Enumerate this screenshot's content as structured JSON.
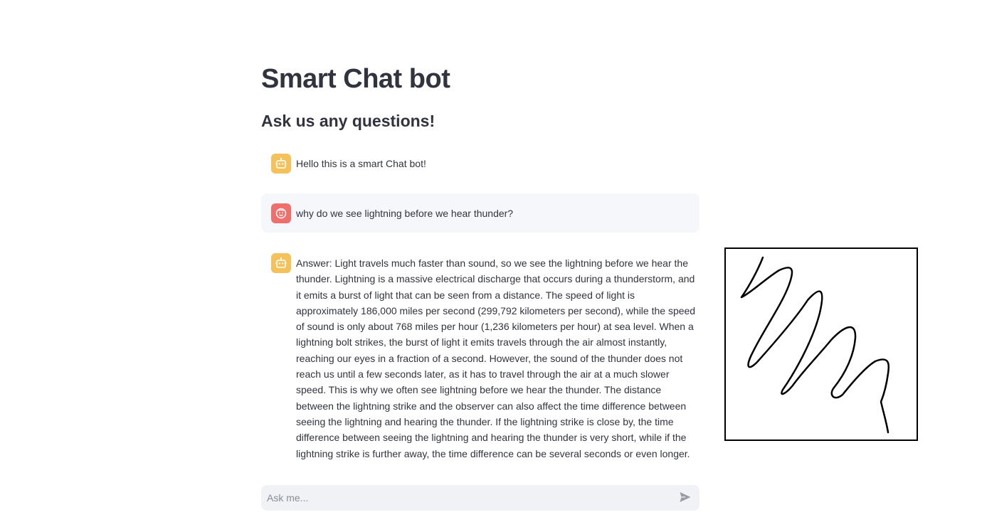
{
  "header": {
    "title": "Smart Chat bot",
    "subtitle": "Ask us any questions!"
  },
  "messages": [
    {
      "role": "assistant",
      "avatar_icon": "robot-face-icon",
      "text": "Hello this is a smart Chat bot!"
    },
    {
      "role": "user",
      "avatar_icon": "smiley-face-icon",
      "text": "why do we see lightning before we hear thunder?"
    },
    {
      "role": "assistant",
      "avatar_icon": "robot-face-icon",
      "text": "Answer: Light travels much faster than sound, so we see the lightning before we hear the thunder. Lightning is a massive electrical discharge that occurs during a thunderstorm, and it emits a burst of light that can be seen from a distance. The speed of light is approximately 186,000 miles per second (299,792 kilometers per second), while the speed of sound is only about 768 miles per hour (1,236 kilometers per hour) at sea level. When a lightning bolt strikes, the burst of light it emits travels through the air almost instantly, reaching our eyes in a fraction of a second. However, the sound of the thunder does not reach us until a few seconds later, as it has to travel through the air at a much slower speed. This is why we often see lightning before we hear the thunder. The distance between the lightning strike and the observer can also affect the time difference between seeing the lightning and hearing the thunder. If the lightning strike is close by, the time difference between seeing the lightning and hearing the thunder is very short, while if the lightning strike is further away, the time difference can be several seconds or even longer."
    }
  ],
  "input": {
    "placeholder": "Ask me...",
    "value": "",
    "send_icon": "send-arrow-icon"
  },
  "colors": {
    "bot_avatar": "#f4c15a",
    "user_avatar": "#ef6f6c",
    "text": "#31333f",
    "input_background": "#f0f2f6"
  }
}
